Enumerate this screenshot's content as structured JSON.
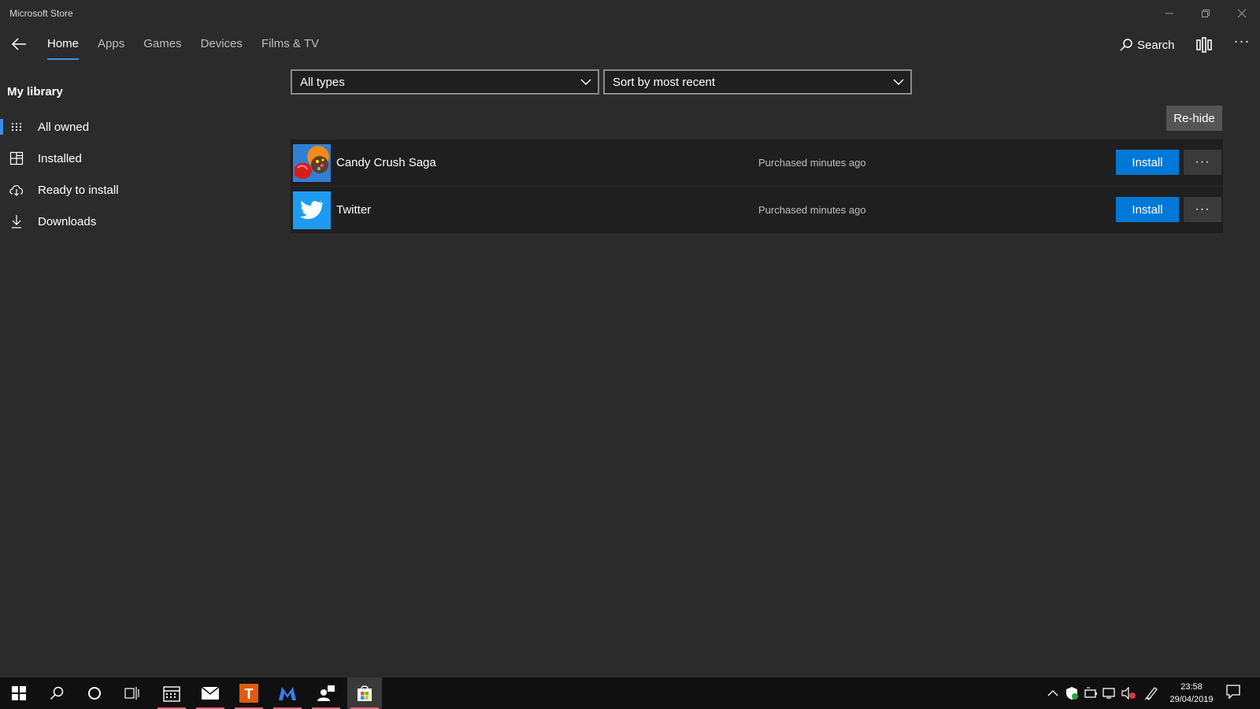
{
  "window": {
    "title": "Microsoft Store",
    "controls": {
      "minimize": "–",
      "restore": "❐",
      "close": "✕"
    }
  },
  "nav": {
    "back_icon": "back-arrow-icon",
    "tabs": [
      {
        "label": "Home",
        "active": true
      },
      {
        "label": "Apps",
        "active": false
      },
      {
        "label": "Games",
        "active": false
      },
      {
        "label": "Devices",
        "active": false
      },
      {
        "label": "Films & TV",
        "active": false
      }
    ],
    "search_label": "Search",
    "more": "···"
  },
  "sidebar": {
    "title": "My library",
    "items": [
      {
        "label": "All owned",
        "icon": "grid-icon",
        "selected": true
      },
      {
        "label": "Installed",
        "icon": "installed-icon",
        "selected": false
      },
      {
        "label": "Ready to install",
        "icon": "cloud-download-icon",
        "selected": false
      },
      {
        "label": "Downloads",
        "icon": "download-icon",
        "selected": false
      }
    ]
  },
  "filters": {
    "type_value": "All types",
    "sort_value": "Sort by most recent"
  },
  "rehide_label": "Re-hide",
  "apps": [
    {
      "name": "Candy Crush Saga",
      "status": "Purchased minutes ago",
      "install_label": "Install",
      "more": "···"
    },
    {
      "name": "Twitter",
      "status": "Purchased minutes ago",
      "install_label": "Install",
      "more": "···"
    }
  ],
  "taskbar": {
    "time": "23:58",
    "date": "29/04/2019"
  },
  "colors": {
    "accent": "#0078d7",
    "nav_indicator": "#3d8ee6",
    "background": "#2b2b2b",
    "row_background": "#1f1f1f"
  }
}
